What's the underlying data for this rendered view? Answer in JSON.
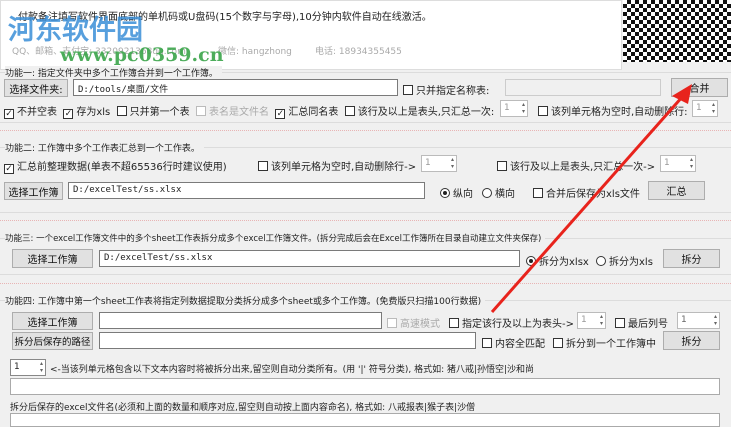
{
  "info": {
    "line1": "付款备注填写软件界面底部的单机码或U盘码(15个数字与字母),10分钟内软件自动在线激活。",
    "contact_qq": "QQ、邮箱、支付宝: 3320921368qq.com",
    "wechat": "微信: hangzhong",
    "phone": "电话: 18934355455"
  },
  "watermark": {
    "name": "河东软件园",
    "url": "www.pc0359.cn"
  },
  "f1": {
    "legend": "功能一: 指定文件夹中多个工作簿合并到一个工作簿。",
    "select_btn": "选择文件夹:",
    "path": "D:/tools/桌面/文件",
    "only_named": "只并指定名称表:",
    "merge_btn": "合并",
    "opts": [
      "不并空表",
      "存为xls",
      "只并第一个表",
      "表名是文件名",
      "汇总同名表",
      "该行及以上是表头,只汇总一次:",
      "该列单元格为空时,自动删除行:"
    ],
    "spin1": "1",
    "spin2": "1"
  },
  "f2": {
    "legend": "功能二: 工作簿中多个工作表汇总到一个工作表。",
    "tidy": "汇总前整理数据(单表不超65536行时建议使用)",
    "del_empty": "该列单元格为空时,自动删除行->",
    "header_once": "该行及以上是表头,只汇总一次->",
    "spin1": "1",
    "spin2": "1",
    "select_btn": "选择工作簿",
    "path": "D:/excelTest/ss.xlsx",
    "vertical": "纵向",
    "horizontal": "横向",
    "save_xls": "合并后保存为xls文件",
    "sum_btn": "汇总"
  },
  "f3": {
    "legend": "功能三: 一个excel工作簿文件中的多个sheet工作表拆分成多个excel工作簿文件。(拆分完成后会在Excel工作簿所在目录自动建立文件夹保存)",
    "select_btn": "选择工作簿",
    "path": "D:/excelTest/ss.xlsx",
    "as_xlsx": "拆分为xlsx",
    "as_xls": "拆分为xls",
    "split_btn": "拆分"
  },
  "f4": {
    "legend": "功能四: 工作簿中第一个sheet工作表将指定列数据提取分类拆分成多个sheet或多个工作簿。(免费版只扫描100行数据)",
    "select_btn": "选择工作簿",
    "path": "",
    "fast": "高速模式",
    "header_row": "指定该行及以上为表头->",
    "spin1": "1",
    "last_col": "最后列号",
    "spin2": "1",
    "save_btn": "拆分后保存的路径",
    "save_path": "",
    "exact": "内容全匹配",
    "one_book": "拆分到一个工作簿中",
    "split_btn": "拆分",
    "col_spin": "1",
    "hint1": "<-当该列单元格包含以下文本内容时将被拆分出来,留空则自动分类所有。(用 '|' 符号分类), 格式如: 猪八戒|孙悟空|沙和尚",
    "filter": "",
    "hint2": "拆分后保存的excel文件名(必须和上面的数量和顺序对应,留空则自动按上面内容命名), 格式如: 八戒报表|猴子表|沙僧",
    "names": ""
  },
  "colors": {
    "arrow": "#e8231c"
  }
}
